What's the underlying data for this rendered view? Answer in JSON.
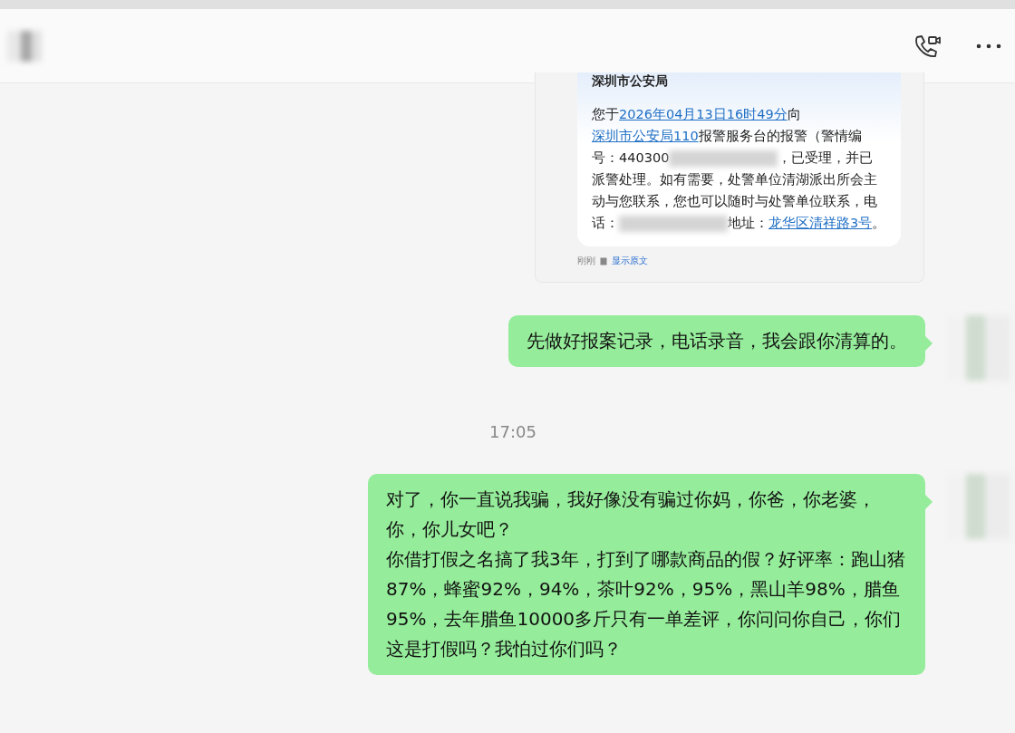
{
  "header": {
    "contact_name_blurred": true
  },
  "messages": [
    {
      "kind": "image_card",
      "card_title": "深圳市公安局",
      "segments": [
        {
          "kind": "text",
          "text": "您于"
        },
        {
          "kind": "link",
          "text": "2026年04月13日16时49分"
        },
        {
          "kind": "text",
          "text": "向"
        },
        {
          "kind": "link",
          "text": "深圳市公安局110"
        },
        {
          "kind": "text",
          "text": "报警服务台的报警（警情编号：440300"
        },
        {
          "kind": "redacted"
        },
        {
          "kind": "text",
          "text": "，已受理，并已派警处理。如有需要，处警单位清湖派出所会主动与您联系，您也可以随时与处警单位联系，电话："
        },
        {
          "kind": "redacted"
        },
        {
          "kind": "text",
          "text": "地址："
        },
        {
          "kind": "link",
          "text": "龙华区清祥路3号"
        },
        {
          "kind": "text",
          "text": "。"
        }
      ],
      "footer_time": "刚刚",
      "footer_link": "显示原文"
    },
    {
      "kind": "bubble",
      "paragraphs": [
        "先做好报案记录，电话录音，我会跟你清算的。"
      ]
    },
    {
      "kind": "time",
      "text": "17:05"
    },
    {
      "kind": "bubble",
      "paragraphs": [
        "对了，你一直说我骗，我好像没有骗过你妈，你爸，你老婆，你，你儿女吧？",
        "你借打假之名搞了我3年，打到了哪款商品的假？好评率：跑山猪87%，蜂蜜92%，94%，茶叶92%，95%，黑山羊98%，腊鱼95%，去年腊鱼10000多斤只有一单差评，你问问你自己，你们这是打假吗？我怕过你们吗？"
      ]
    }
  ]
}
